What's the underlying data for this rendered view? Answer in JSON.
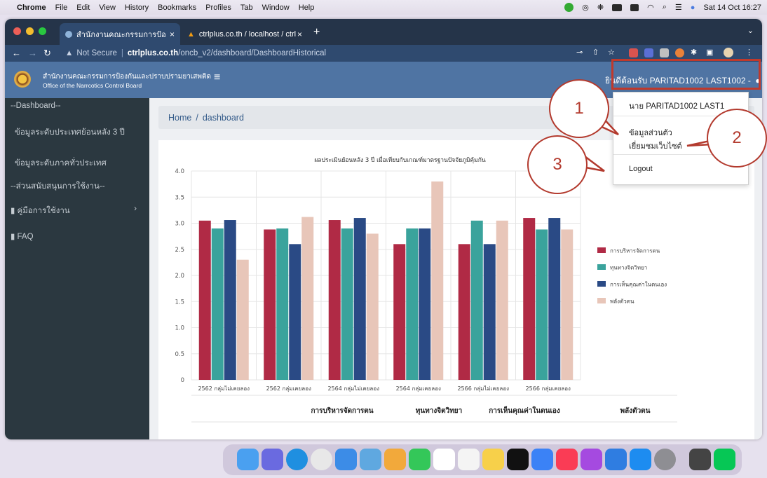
{
  "menubar": {
    "app": "Chrome",
    "items": [
      "File",
      "Edit",
      "View",
      "History",
      "Bookmarks",
      "Profiles",
      "Tab",
      "Window",
      "Help"
    ],
    "clock": "Sat 14 Oct  16:27"
  },
  "browser": {
    "tabs": [
      {
        "title": "สำนักงานคณะกรรมการป้องกันและ"
      },
      {
        "title": "ctrlplus.co.th / localhost / ctrlp"
      }
    ],
    "security_label": "Not Secure",
    "url_host": "ctrlplus.co.th",
    "url_path": "/oncb_v2/dashboard/DashboardHistorical"
  },
  "header": {
    "org_th": "สำนักงานคณะกรรมการป้องกันและปราบปรามยาเสพติด",
    "org_en": "Office of the Narrcotics Control Board",
    "welcome": "ยินดีต้อนรับ PARITAD1002 LAST1002 -"
  },
  "sidebar": {
    "section1": "--Dashboard--",
    "item1": "ข้อมูลระดับประเทศย้อนหลัง 3 ปี",
    "item2": "ข้อมูลระดับภาคทั่วประเทศ",
    "section2": "--ส่วนสนับสนุนการใช้งาน--",
    "item3": "คู่มือการใช้งาน",
    "item4": "FAQ"
  },
  "breadcrumb": {
    "home": "Home",
    "sep": "/",
    "current": "dashboard"
  },
  "dropdown": {
    "name": "นาย PARITAD1002 LAST1",
    "profile": "ข้อมูลส่วนตัว",
    "visit": "เยี่ยมชมเว็บไซต์",
    "logout": "Logout"
  },
  "callouts": [
    "1",
    "2",
    "3"
  ],
  "chart_data": {
    "type": "bar",
    "title": "ผลประเมินย้อนหลัง 3 ปี เมื่อเทียบกับเกณฑ์มาตรฐานปัจจัยภูมิคุ้มกัน",
    "categories": [
      "2562 กลุ่มไม่เคยลอง",
      "2562  กลุ่มเคยลอง",
      "2564 กลุ่มไม่เคยลอง",
      "2564  กลุ่มเคยลอง",
      "2566 กลุ่มไม่เคยลอง",
      "2566  กลุ่มเคยลอง"
    ],
    "series": [
      {
        "name": "การบริหารจัดการตน",
        "color": "#b02a45",
        "values": [
          3.05,
          2.88,
          3.06,
          2.6,
          2.6,
          3.1
        ]
      },
      {
        "name": "ทุนทางจิตวิทยา",
        "color": "#3aa39c",
        "values": [
          2.9,
          2.9,
          2.9,
          2.9,
          3.05,
          2.88
        ]
      },
      {
        "name": "การเห็นคุณค่าในตนเอง",
        "color": "#2a4a85",
        "values": [
          3.06,
          2.6,
          3.1,
          2.9,
          2.6,
          3.1
        ]
      },
      {
        "name": "พลังตัวตน",
        "color": "#e8c6b9",
        "values": [
          2.3,
          3.12,
          2.8,
          3.8,
          3.05,
          2.88
        ]
      }
    ],
    "ylim": [
      0,
      4.0
    ],
    "yticks": [
      "0",
      "0.5",
      "1.0",
      "1.5",
      "2.0",
      "2.5",
      "3.0",
      "3.5",
      "4.0"
    ],
    "legend_position": "right",
    "grid": true
  },
  "table": {
    "headers": [
      "การบริหารจัดการตน",
      "ทุนทางจิตวิทยา",
      "การเห็นคุณค่าในตนเอง",
      "พลังตัวตน"
    ]
  }
}
